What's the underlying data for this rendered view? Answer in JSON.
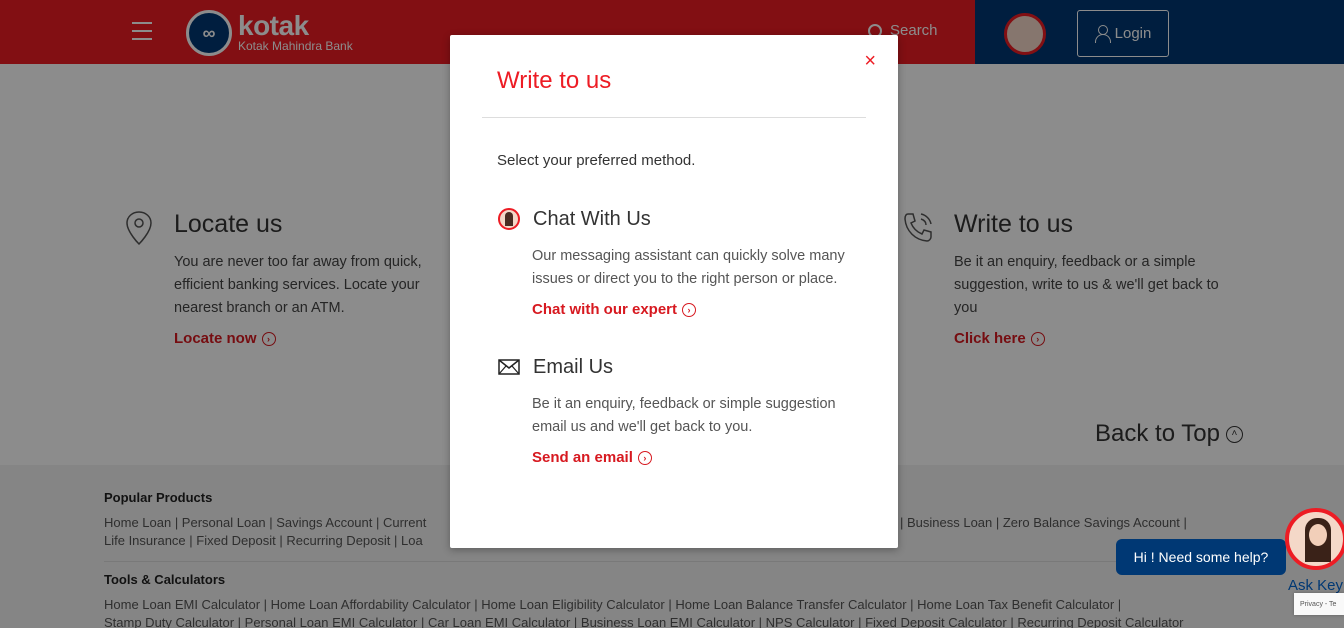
{
  "header": {
    "logo_name": "kotak",
    "logo_sub": "Kotak Mahindra Bank",
    "search_label": "Search",
    "login_label": "Login"
  },
  "cards": [
    {
      "icon": "location-pin-icon",
      "title": "Locate us",
      "desc": "You are never too far away from quick, efficient banking services. Locate your nearest branch or an ATM.",
      "cta": "Locate now"
    },
    {
      "icon": "phone-icon",
      "title": "Write to us",
      "desc": "Be it an enquiry, feedback or a simple suggestion, write to us & we'll get back to you",
      "cta": "Click here"
    }
  ],
  "back_to_top": "Back to Top",
  "footer": {
    "popular_title": "Popular Products",
    "popular_links_1": "Home Loan  |  Personal Loan  |  Savings Account  |  Current",
    "popular_links_1b": "|  Business Loan  |  Zero Balance Savings Account  |",
    "popular_links_2": "Life Insurance  |  Fixed Deposit  |  Recurring Deposit  |  Loa",
    "tools_title": "Tools & Calculators",
    "tools_links_1": "Home Loan EMI Calculator  |  Home Loan Affordability Calculator  |  Home Loan Eligibility Calculator  |  Home Loan Balance Transfer Calculator  |  Home Loan Tax Benefit Calculator  |",
    "tools_links_2": "Stamp Duty Calculator  |  Personal Loan EMI Calculator  |  Car Loan EMI Calculator  |  Business Loan EMI Calculator  |  NPS Calculator  |  Fixed Deposit Calculator  |  Recurring Deposit Calculator"
  },
  "modal": {
    "title": "Write to us",
    "close": "×",
    "intro": "Select your preferred method.",
    "options": [
      {
        "icon": "assistant-avatar-icon",
        "title": "Chat With Us",
        "desc": "Our messaging assistant can quickly solve many issues or direct you to the right person or place.",
        "link": "Chat with our expert"
      },
      {
        "icon": "envelope-icon",
        "title": "Email Us",
        "desc": "Be it an enquiry, feedback or simple suggestion email us and we'll get back to you.",
        "link": "Send an email"
      }
    ]
  },
  "chat_widget": {
    "bubble": "Hi ! Need some help?",
    "ask_label": "Ask Key",
    "recaptcha": "Privacy - Te"
  },
  "colors": {
    "brand_red": "#ed1c24",
    "brand_blue": "#003874",
    "link_red": "#d71920"
  }
}
